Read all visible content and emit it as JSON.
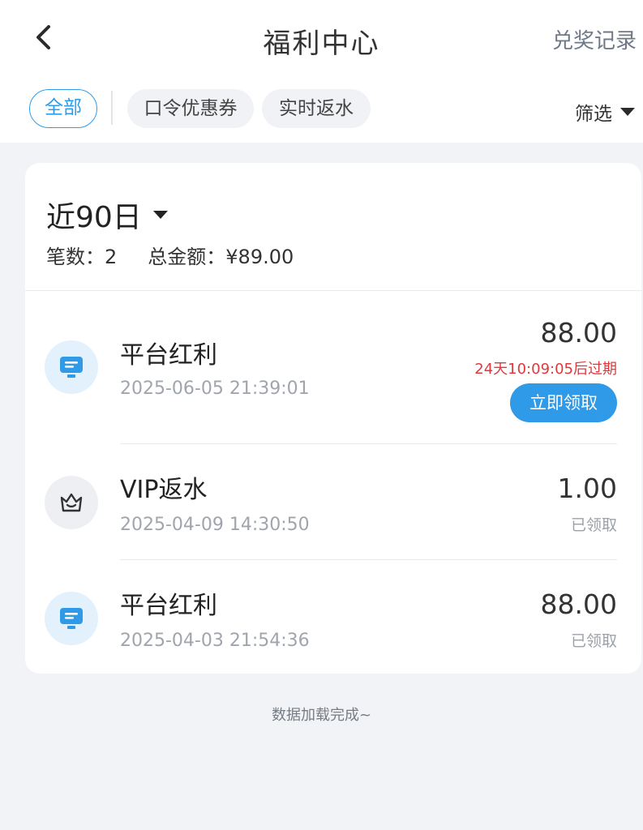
{
  "header": {
    "title": "福利中心",
    "records_link": "兑奖记录"
  },
  "tabs": {
    "all": "全部",
    "coupon": "口令优惠券",
    "rebate": "实时返水",
    "filter": "筛选"
  },
  "summary": {
    "range": "近90日",
    "count_label": "笔数：",
    "count": "2",
    "total_label": "总金额：",
    "total": "¥89.00"
  },
  "records": [
    {
      "title": "平台红利",
      "time": "2025-06-05 21:39:01",
      "amount": "88.00",
      "expiry": "24天10:09:05后过期",
      "action": "立即领取",
      "icon": "monitor-icon"
    },
    {
      "title": "VIP返水",
      "time": "2025-04-09 14:30:50",
      "amount": "1.00",
      "status": "已领取",
      "icon": "crown-icon"
    },
    {
      "title": "平台红利",
      "time": "2025-04-03 21:54:36",
      "amount": "88.00",
      "status": "已领取",
      "icon": "monitor-icon"
    }
  ],
  "footer": {
    "note": "数据加载完成~"
  },
  "colors": {
    "accent": "#2f9ae8",
    "expiry": "#e0383d",
    "background": "#f2f3f6"
  }
}
